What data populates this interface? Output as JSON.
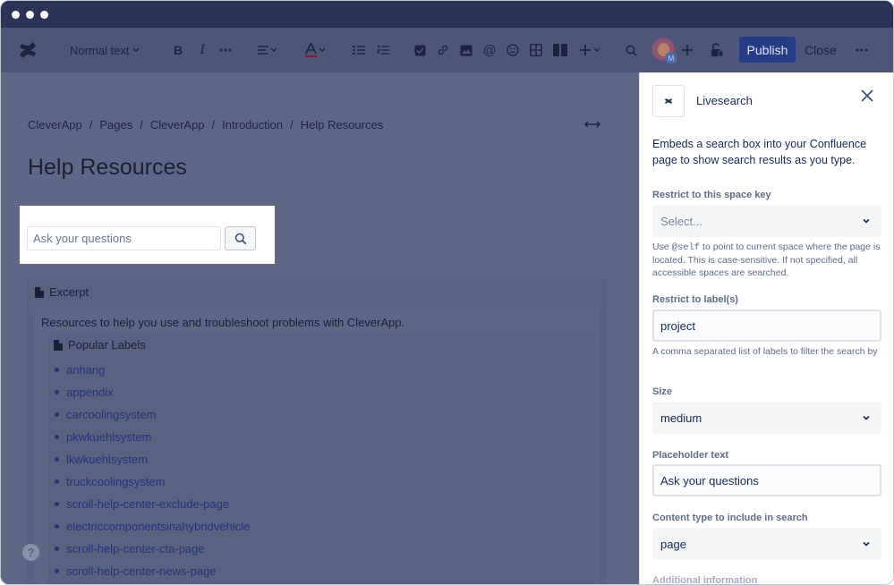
{
  "toolbar": {
    "text_style": "Normal text",
    "publish_label": "Publish",
    "close_label": "Close",
    "avatar_badge": "M"
  },
  "page": {
    "breadcrumb": [
      "CleverApp",
      "Pages",
      "CleverApp",
      "Introduction",
      "Help Resources"
    ],
    "breadcrumb_separator": "/",
    "title": "Help Resources",
    "search_placeholder": "Ask your questions",
    "excerpt_title": "Excerpt",
    "excerpt_text": "Resources to help you use and troubleshoot problems with CleverApp.",
    "labels_title": "Popular Labels",
    "labels": [
      "anhang",
      "appendix",
      "carcoolingsystem",
      "pkwkuehlsystem",
      "lkwkuehlsystem",
      "truckcoolingsystem",
      "scroll-help-center-exclude-page",
      "electriccomponentsinahybridvehicle",
      "scroll-help-center-cta-page",
      "scroll-help-center-news-page"
    ],
    "help_glyph": "?"
  },
  "panel": {
    "title": "Livesearch",
    "description": "Embeds a search box into your Confluence page to show search results as you type.",
    "space_key": {
      "label": "Restrict to this space key",
      "placeholder": "Select...",
      "help_before": "Use ",
      "help_code": "@self",
      "help_after": " to point to current space where the page is located. This is case-sensitive. If not specified, all accessible spaces are searched."
    },
    "labels_field": {
      "label": "Restrict to label(s)",
      "value": "project",
      "help": "A comma separated list of labels to filter the search by"
    },
    "size": {
      "label": "Size",
      "value": "medium"
    },
    "placeholder_text": {
      "label": "Placeholder text",
      "value": "Ask your questions"
    },
    "content_type": {
      "label": "Content type to include in search",
      "value": "page"
    },
    "additional_info_label": "Additional information"
  },
  "colors": {
    "publish_bg": "#253d85",
    "link": "#23357a",
    "overlay": "#5f6786"
  }
}
